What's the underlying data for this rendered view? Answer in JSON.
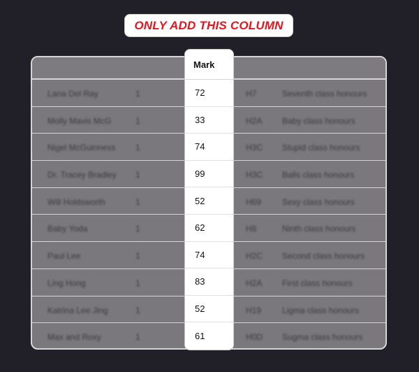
{
  "callout": {
    "text": "ONLY ADD THIS COLUMN"
  },
  "mark_column": {
    "header": "Mark",
    "values": [
      "72",
      "33",
      "74",
      "99",
      "52",
      "62",
      "74",
      "83",
      "52",
      "61"
    ]
  },
  "rows": [
    {
      "name": "Lana Del Ray",
      "one": "1",
      "code": "H7",
      "class": "Seventh class honours"
    },
    {
      "name": "Molly Mavis McG",
      "one": "1",
      "code": "H2A",
      "class": "Baby class honours"
    },
    {
      "name": "Nigel McGuinness",
      "one": "1",
      "code": "H3C",
      "class": "Stupid class honours"
    },
    {
      "name": "Dr. Tracey Bradley",
      "one": "1",
      "code": "H3C",
      "class": "Balls class honours"
    },
    {
      "name": "Will Holdsworth",
      "one": "1",
      "code": "H69",
      "class": "Sexy class honours"
    },
    {
      "name": "Baby Yoda",
      "one": "1",
      "code": "H8",
      "class": "Ninth class honours"
    },
    {
      "name": "Paul Lee",
      "one": "1",
      "code": "H2C",
      "class": "Second class honours"
    },
    {
      "name": "Ling Hong",
      "one": "1",
      "code": "H2A",
      "class": "First class honours"
    },
    {
      "name": "Katrina Lee Jing",
      "one": "1",
      "code": "H19",
      "class": "Ligma class honours"
    },
    {
      "name": "Max and Roxy",
      "one": "1",
      "code": "H0D",
      "class": "Sugma class honours"
    }
  ]
}
